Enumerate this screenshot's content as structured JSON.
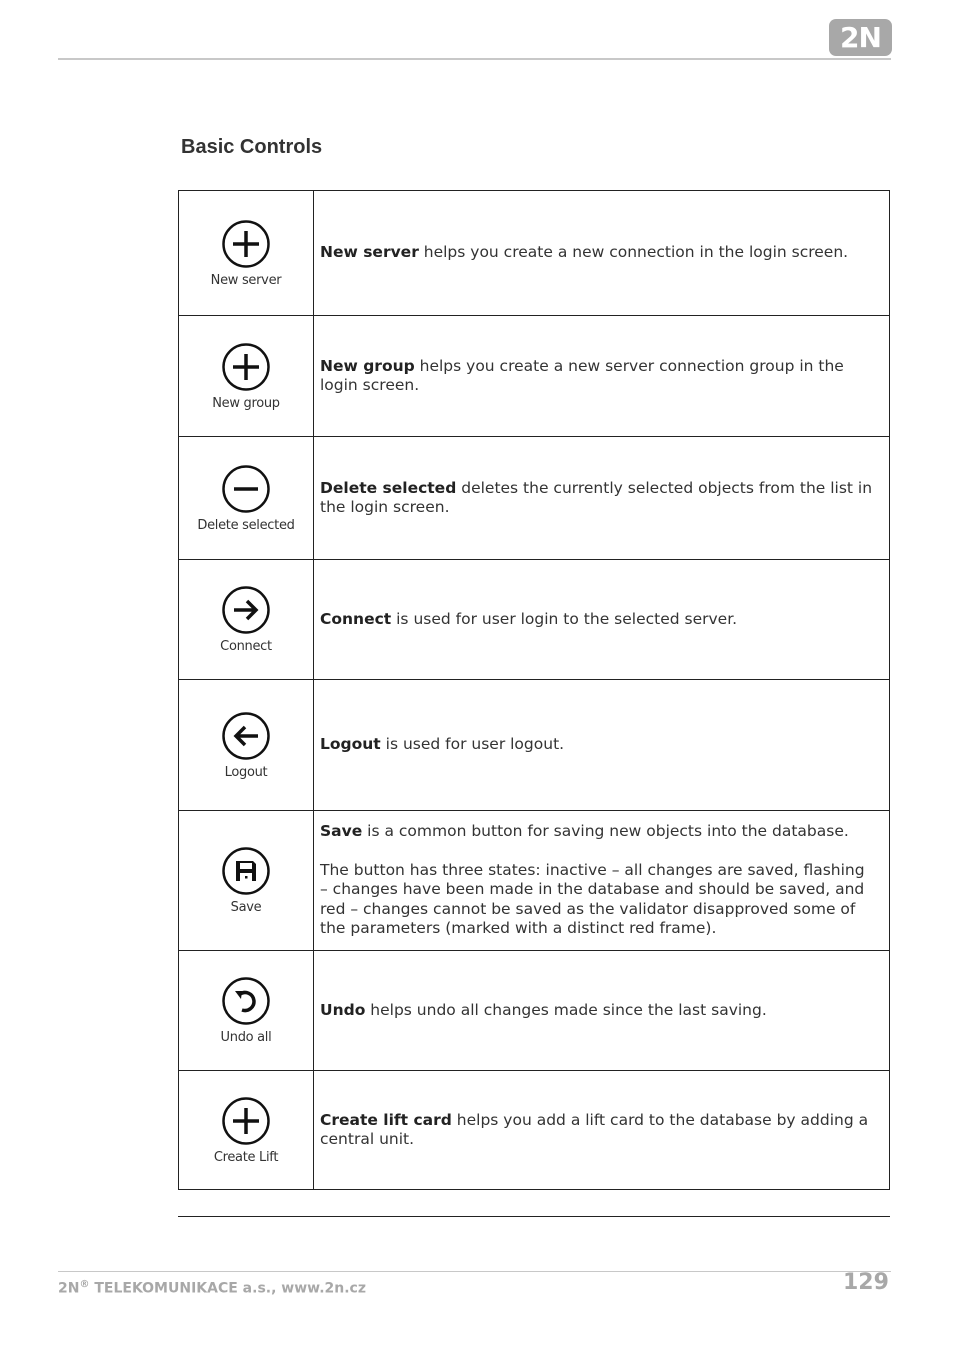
{
  "header": {
    "logo_text": "2N"
  },
  "section_title": "Basic Controls",
  "controls": [
    {
      "icon": "plus-circle-icon",
      "label": "New server",
      "bold": "New server",
      "text": " helps you create a new connection in the login screen."
    },
    {
      "icon": "plus-circle-icon",
      "label": "New group",
      "bold": "New group",
      "text": " helps you create a new server connection group in the login screen."
    },
    {
      "icon": "minus-circle-icon",
      "label": "Delete selected",
      "bold": "Delete selected",
      "text": " deletes the currently selected objects from the list in the login screen."
    },
    {
      "icon": "arrow-right-circle-icon",
      "label": "Connect",
      "bold": "Connect",
      "text": " is used for user login to the selected server."
    },
    {
      "icon": "arrow-left-circle-icon",
      "label": "Logout",
      "bold": "Logout",
      "text": " is used for user logout."
    },
    {
      "icon": "save-icon",
      "label": "Save",
      "bold": "Save",
      "text": " is a common button for saving new objects into the database.",
      "text2": "The button has three states: inactive – all changes are saved, flashing – changes have been made in the database and should be saved, and red – changes cannot be saved as the validator disapproved some of the parameters (marked with a distinct red frame)."
    },
    {
      "icon": "undo-icon",
      "label": "Undo all",
      "bold": "Undo",
      "text": " helps undo all changes made since the last saving."
    },
    {
      "icon": "plus-circle-icon",
      "label": "Create Lift",
      "bold": "Create lift card",
      "text": " helps you add a lift card to the database by adding a central unit."
    }
  ],
  "footer": {
    "company_prefix": "2N",
    "registered": "®",
    "company_rest": " TELEKOMUNIKACE a.s., www.2n.cz",
    "page_number": "129"
  }
}
